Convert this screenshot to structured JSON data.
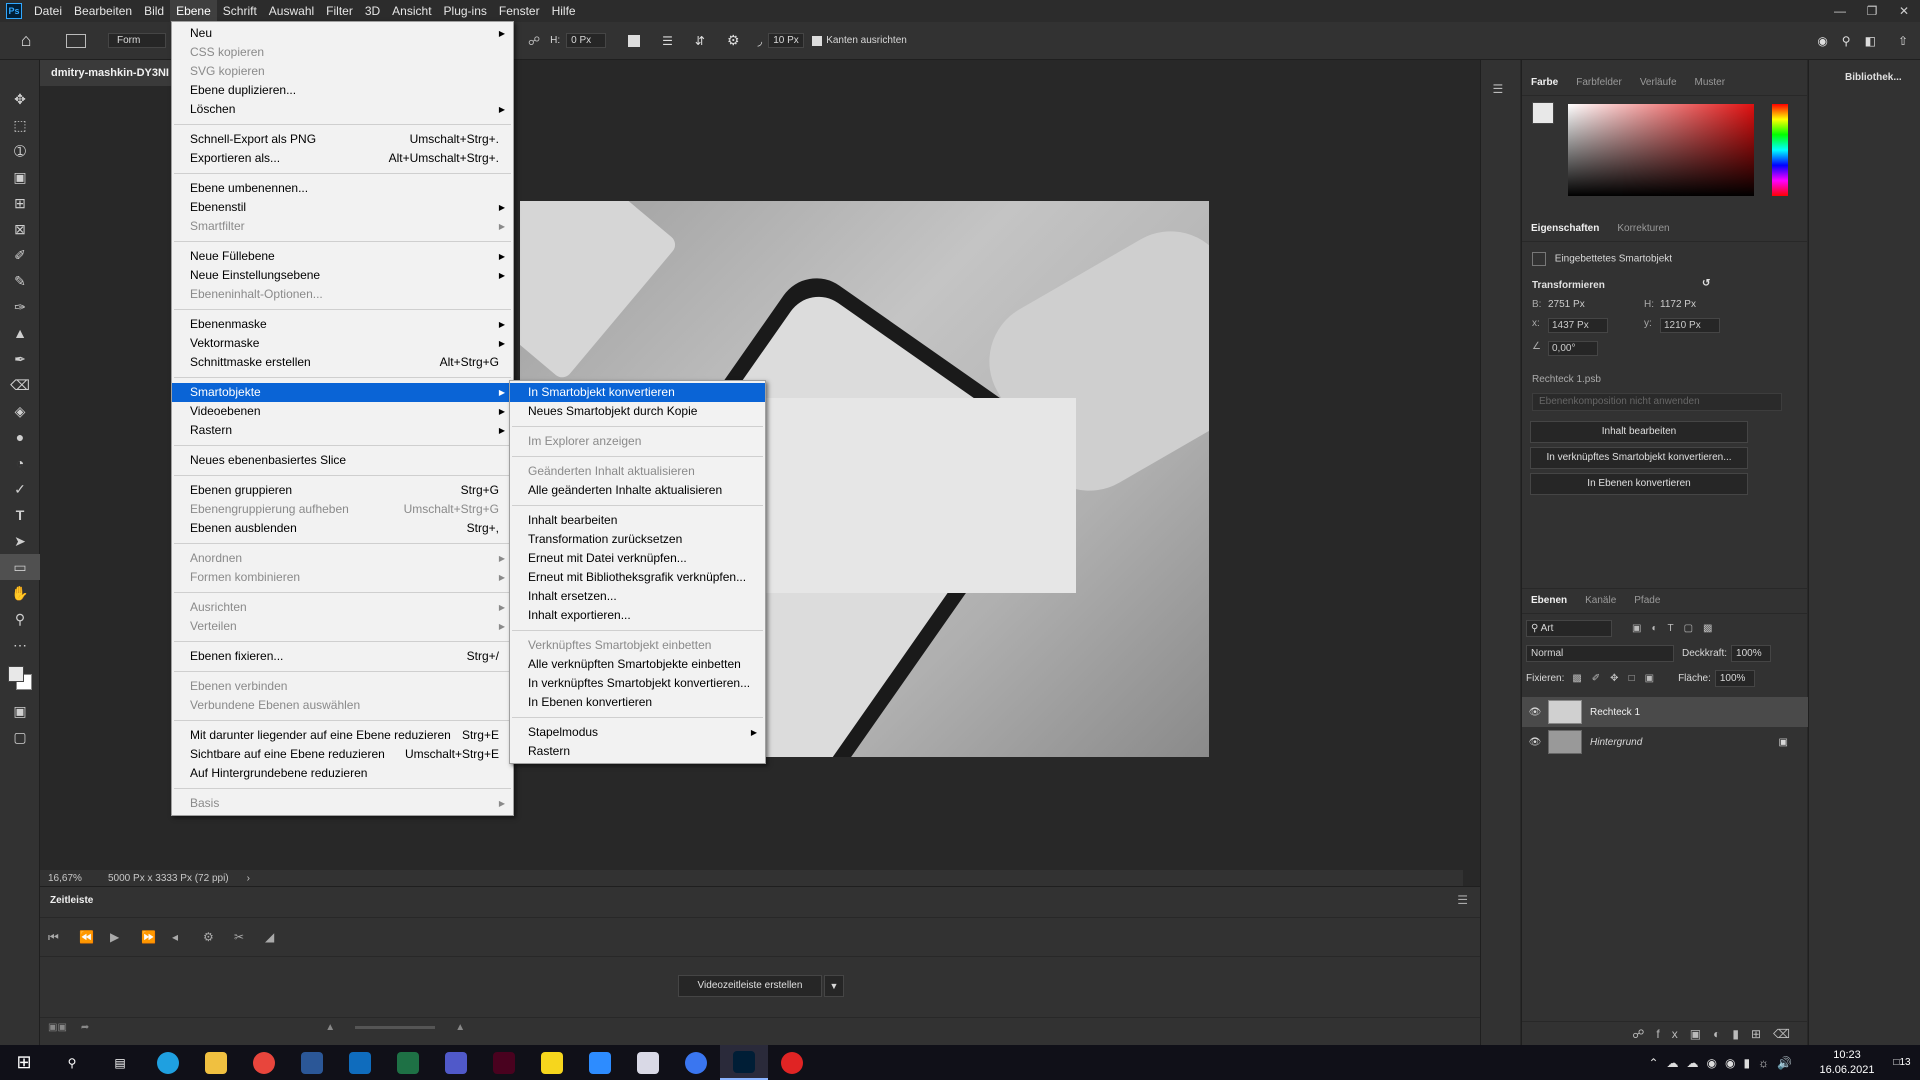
{
  "menubar": {
    "logo": "Ps",
    "items": [
      "Datei",
      "Bearbeiten",
      "Bild",
      "Ebene",
      "Schrift",
      "Auswahl",
      "Filter",
      "3D",
      "Ansicht",
      "Plug-ins",
      "Fenster",
      "Hilfe"
    ],
    "active": "Ebene"
  },
  "options": {
    "mode": "Form",
    "h_label": "H:",
    "h_value": "0 Px",
    "radius": "10 Px",
    "align_edges": "Kanten ausrichten"
  },
  "document": {
    "tab_title": "dmitry-mashkin-DY3NI",
    "zoom": "16,67%",
    "size_info": "5000 Px x 3333 Px (72 ppi)"
  },
  "timeline": {
    "title": "Zeitleiste",
    "create_button": "Videozeitleiste erstellen"
  },
  "ebene_menu": [
    {
      "label": "Neu",
      "shortcut": "",
      "sub": true,
      "disabled": false
    },
    {
      "label": "CSS kopieren",
      "shortcut": "",
      "sub": false,
      "disabled": true
    },
    {
      "label": "SVG kopieren",
      "shortcut": "",
      "sub": false,
      "disabled": true
    },
    {
      "label": "Ebene duplizieren...",
      "shortcut": "",
      "sub": false,
      "disabled": false
    },
    {
      "label": "Löschen",
      "shortcut": "",
      "sub": true,
      "disabled": false
    },
    {
      "sep": true
    },
    {
      "label": "Schnell-Export als PNG",
      "shortcut": "Umschalt+Strg+.",
      "sub": false,
      "disabled": false
    },
    {
      "label": "Exportieren als...",
      "shortcut": "Alt+Umschalt+Strg+.",
      "sub": false,
      "disabled": false
    },
    {
      "sep": true
    },
    {
      "label": "Ebene umbenennen...",
      "shortcut": "",
      "sub": false,
      "disabled": false
    },
    {
      "label": "Ebenenstil",
      "shortcut": "",
      "sub": true,
      "disabled": false
    },
    {
      "label": "Smartfilter",
      "shortcut": "",
      "sub": true,
      "disabled": true
    },
    {
      "sep": true
    },
    {
      "label": "Neue Füllebene",
      "shortcut": "",
      "sub": true,
      "disabled": false
    },
    {
      "label": "Neue Einstellungsebene",
      "shortcut": "",
      "sub": true,
      "disabled": false
    },
    {
      "label": "Ebeneninhalt-Optionen...",
      "shortcut": "",
      "sub": false,
      "disabled": true
    },
    {
      "sep": true
    },
    {
      "label": "Ebenenmaske",
      "shortcut": "",
      "sub": true,
      "disabled": false
    },
    {
      "label": "Vektormaske",
      "shortcut": "",
      "sub": true,
      "disabled": false
    },
    {
      "label": "Schnittmaske erstellen",
      "shortcut": "Alt+Strg+G",
      "sub": false,
      "disabled": false
    },
    {
      "sep": true
    },
    {
      "label": "Smartobjekte",
      "shortcut": "",
      "sub": true,
      "disabled": false,
      "highlight": true
    },
    {
      "label": "Videoebenen",
      "shortcut": "",
      "sub": true,
      "disabled": false
    },
    {
      "label": "Rastern",
      "shortcut": "",
      "sub": true,
      "disabled": false
    },
    {
      "sep": true
    },
    {
      "label": "Neues ebenenbasiertes Slice",
      "shortcut": "",
      "sub": false,
      "disabled": false
    },
    {
      "sep": true
    },
    {
      "label": "Ebenen gruppieren",
      "shortcut": "Strg+G",
      "sub": false,
      "disabled": false
    },
    {
      "label": "Ebenengruppierung aufheben",
      "shortcut": "Umschalt+Strg+G",
      "sub": false,
      "disabled": true
    },
    {
      "label": "Ebenen ausblenden",
      "shortcut": "Strg+,",
      "sub": false,
      "disabled": false
    },
    {
      "sep": true
    },
    {
      "label": "Anordnen",
      "shortcut": "",
      "sub": true,
      "disabled": true
    },
    {
      "label": "Formen kombinieren",
      "shortcut": "",
      "sub": true,
      "disabled": true
    },
    {
      "sep": true
    },
    {
      "label": "Ausrichten",
      "shortcut": "",
      "sub": true,
      "disabled": true
    },
    {
      "label": "Verteilen",
      "shortcut": "",
      "sub": true,
      "disabled": true
    },
    {
      "sep": true
    },
    {
      "label": "Ebenen fixieren...",
      "shortcut": "Strg+/",
      "sub": false,
      "disabled": false
    },
    {
      "sep": true
    },
    {
      "label": "Ebenen verbinden",
      "shortcut": "",
      "sub": false,
      "disabled": true
    },
    {
      "label": "Verbundene Ebenen auswählen",
      "shortcut": "",
      "sub": false,
      "disabled": true
    },
    {
      "sep": true
    },
    {
      "label": "Mit darunter liegender auf eine Ebene reduzieren",
      "shortcut": "Strg+E",
      "sub": false,
      "disabled": false
    },
    {
      "label": "Sichtbare auf eine Ebene reduzieren",
      "shortcut": "Umschalt+Strg+E",
      "sub": false,
      "disabled": false
    },
    {
      "label": "Auf Hintergrundebene reduzieren",
      "shortcut": "",
      "sub": false,
      "disabled": false
    },
    {
      "sep": true
    },
    {
      "label": "Basis",
      "shortcut": "",
      "sub": true,
      "disabled": true
    }
  ],
  "smart_menu": [
    {
      "label": "In Smartobjekt konvertieren",
      "disabled": false,
      "highlight": true
    },
    {
      "label": "Neues Smartobjekt durch Kopie",
      "disabled": false
    },
    {
      "sep": true
    },
    {
      "label": "Im Explorer anzeigen",
      "disabled": true
    },
    {
      "sep": true
    },
    {
      "label": "Geänderten Inhalt aktualisieren",
      "disabled": true
    },
    {
      "label": "Alle geänderten Inhalte aktualisieren",
      "disabled": false
    },
    {
      "sep": true
    },
    {
      "label": "Inhalt bearbeiten",
      "disabled": false
    },
    {
      "label": "Transformation zurücksetzen",
      "disabled": false
    },
    {
      "label": "Erneut mit Datei verknüpfen...",
      "disabled": false
    },
    {
      "label": "Erneut mit Bibliotheksgrafik verknüpfen...",
      "disabled": false
    },
    {
      "label": "Inhalt ersetzen...",
      "disabled": false
    },
    {
      "label": "Inhalt exportieren...",
      "disabled": false
    },
    {
      "sep": true
    },
    {
      "label": "Verknüpftes Smartobjekt einbetten",
      "disabled": true
    },
    {
      "label": "Alle verknüpften Smartobjekte einbetten",
      "disabled": false
    },
    {
      "label": "In verknüpftes Smartobjekt konvertieren...",
      "disabled": false
    },
    {
      "label": "In Ebenen konvertieren",
      "disabled": false
    },
    {
      "sep": true
    },
    {
      "label": "Stapelmodus",
      "disabled": false,
      "sub": true
    },
    {
      "label": "Rastern",
      "disabled": false
    }
  ],
  "color_panel": {
    "tabs": [
      "Farbe",
      "Farbfelder",
      "Verläufe",
      "Muster"
    ]
  },
  "properties": {
    "tabs": [
      "Eigenschaften",
      "Korrekturen"
    ],
    "object_type": "Eingebettetes Smartobjekt",
    "section": "Transformieren",
    "w_label": "B:",
    "w": "2751 Px",
    "h_label": "H:",
    "h": "1172 Px",
    "x_label": "x:",
    "x": "1437 Px",
    "y_label": "y:",
    "y": "1210 Px",
    "angle": "0,00°",
    "file": "Rechteck 1.psb",
    "comp_placeholder": "Ebenenkomposition nicht anwenden",
    "buttons": [
      "Inhalt bearbeiten",
      "In verknüpftes Smartobjekt konvertieren...",
      "In Ebenen konvertieren"
    ]
  },
  "layers": {
    "tabs": [
      "Ebenen",
      "Kanäle",
      "Pfade"
    ],
    "filter": "Art",
    "blend": "Normal",
    "opacity_label": "Deckkraft:",
    "opacity": "100%",
    "lock_label": "Fixieren:",
    "fill_label": "Fläche:",
    "fill": "100%",
    "items": [
      "Rechteck 1",
      "Hintergrund"
    ]
  },
  "library": {
    "label": "Bibliothek..."
  },
  "taskbar": {
    "time": "10:23",
    "date": "16.06.2021",
    "notif": "13",
    "icons": [
      {
        "name": "edge",
        "color": "#1fa0e0"
      },
      {
        "name": "explorer",
        "color": "#f0c040"
      },
      {
        "name": "chrome",
        "color": "#e8453c"
      },
      {
        "name": "word",
        "color": "#2b5797"
      },
      {
        "name": "outlook",
        "color": "#0f6cbd"
      },
      {
        "name": "excel",
        "color": "#1e7145"
      },
      {
        "name": "teams",
        "color": "#5059c9"
      },
      {
        "name": "indesign",
        "color": "#49021f"
      },
      {
        "name": "sticky",
        "color": "#f6d61d"
      },
      {
        "name": "zoom",
        "color": "#2d8cff"
      },
      {
        "name": "app",
        "color": "#d9d9e6"
      },
      {
        "name": "signal",
        "color": "#3a76f0"
      },
      {
        "name": "photoshop",
        "color": "#001e36"
      },
      {
        "name": "recorder",
        "color": "#e02424"
      }
    ]
  }
}
